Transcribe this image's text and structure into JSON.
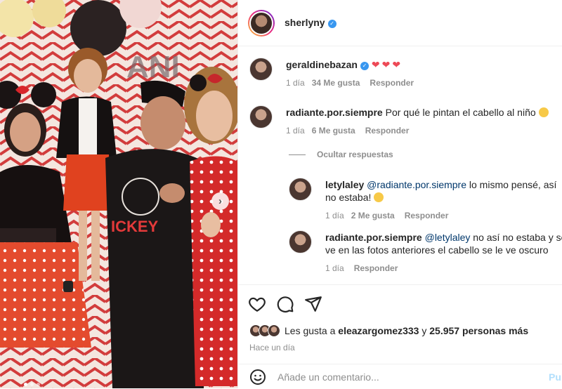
{
  "post": {
    "author": "sherlyny",
    "photo_pages": 3,
    "photo_active_page": 1
  },
  "comments": [
    {
      "user": "geraldinebazan",
      "text": "",
      "hearts": "❤❤❤",
      "time": "1 día",
      "likes": "34 Me gusta",
      "reply": "Responder"
    },
    {
      "user": "radiante.por.siempre",
      "text": "Por qué le pintan el cabello al niño",
      "time": "1 día",
      "likes": "6 Me gusta",
      "reply": "Responder"
    }
  ],
  "hide_replies": "Ocultar respuestas",
  "replies": [
    {
      "user": "letylaley",
      "mention": "@radiante.por.siempre",
      "text_line1": "lo mismo pensé, así",
      "text_line2": "no estaba!",
      "time": "1 día",
      "likes": "2 Me gusta",
      "reply": "Responder"
    },
    {
      "user": "radiante.por.siempre",
      "mention": "@letylaley",
      "text_line1": "no así no estaba y se",
      "text_line2": "ve en las fotos anteriores el cabello se le ve oscuro",
      "time": "1 día",
      "reply": "Responder"
    }
  ],
  "likes_summary": {
    "prefix": "Les gusta a",
    "user": "eleazargomez333",
    "middle": "y",
    "others": "25.957 personas más"
  },
  "time_ago": "Hace un día",
  "add_comment": {
    "placeholder": "Añade un comentario...",
    "post_label": "Pu"
  },
  "icons": {
    "like": "heart-icon",
    "comment": "comment-icon",
    "share": "share-icon",
    "emoji": "smile-icon",
    "next": "chevron-right-icon"
  },
  "colors": {
    "verified": "#3897f0",
    "heart": "#ed4956",
    "mention": "#00376b",
    "muted": "#8e8e8e",
    "post_button": "#b2dffc"
  }
}
